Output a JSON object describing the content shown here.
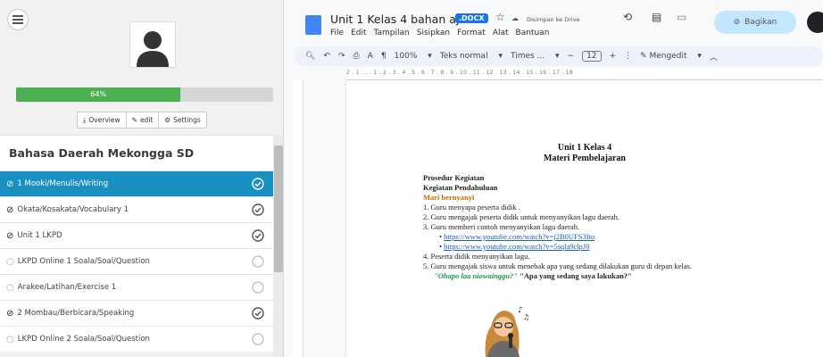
{
  "sidebar": {
    "progress_label": "64%",
    "progress_value": 0.64,
    "buttons": [
      "Overview",
      "edit",
      "Settings"
    ],
    "course_title": "Bahasa Daerah Mekongga SD",
    "items": [
      {
        "label": "1 Mooki/Menulis/Writing",
        "done": true,
        "active": true
      },
      {
        "label": "Okata/Kosakata/Vocabulary 1",
        "done": true,
        "active": false
      },
      {
        "label": "Unit 1 LKPD",
        "done": true,
        "active": false
      },
      {
        "label": "LKPD Online 1 Soala/Soal/Question",
        "done": false,
        "active": false
      },
      {
        "label": "Arakee/Latihan/Exercise 1",
        "done": false,
        "active": false
      },
      {
        "label": "2 Mombau/Berbicara/Speaking",
        "done": true,
        "active": false
      },
      {
        "label": "LKPD Online 2 Soala/Soal/Question",
        "done": false,
        "active": false
      }
    ],
    "accent_color": "#1a8fc2",
    "progress_color": "#4caf50"
  },
  "doc": {
    "title": "Unit 1 Kelas 4 bahan ajar",
    "badge": ".DOCX",
    "saved": "Disimpan ke Drive",
    "menus": [
      "File",
      "Edit",
      "Tampilan",
      "Sisipkan",
      "Format",
      "Alat",
      "Bantuan"
    ],
    "share_label": "Bagikan",
    "zoom": "100%",
    "style": "Teks normal",
    "font": "Times ...",
    "font_size": "12",
    "mode": "Mengedit",
    "ruler": "2 . 1 . . . 1 . 2 . 3 . 4 . 5 . 6 . 7 . 8 . 9 . 10 . 11 . 12 . 13 . 14 . 15 . 16 . 17 . 18"
  },
  "page": {
    "heading1": "Unit 1 Kelas 4",
    "heading2": "Materi Pembelajaran",
    "lines": {
      "prosedur": "Prosedur Kegiatan",
      "pendahuluan": "Kegiatan Pendahuluan",
      "mari": "Mari bernyanyi",
      "s1": "1.  Guru menyapa peserta didik .",
      "s2": "2.  Guru mengajak peserta didik untuk menyanyikan lagu daerah.",
      "s3": "3.  Guru memberi contoh menyanyikan lagu daerah.",
      "link1": "https://www.youtube.com/watch?v=j2B0UFS3Ito",
      "link2": "https://www.youtube.com/watch?v=5sqla9clpJ0",
      "s4": "4.  Peserta didik menyanyikan lagu.",
      "s5": "5.  Guru mengajak siswa untuk menebak apa yang sedang dilakukan guru di depan kelas.",
      "quote_green": "\"Ohapo laa niowainggu?\"",
      "quote_black": "\"Apa yang sedang saya lakukan?\""
    }
  }
}
